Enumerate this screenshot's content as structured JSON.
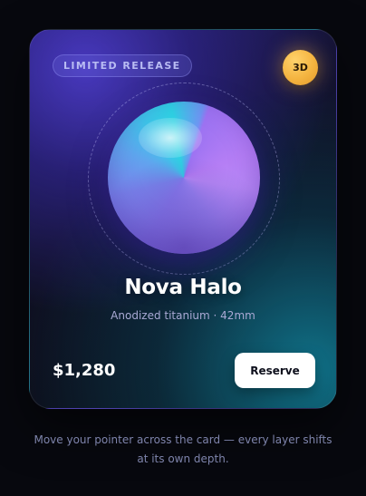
{
  "card": {
    "badge": "LIMITED RELEASE",
    "mode_chip": "3D",
    "title": "Nova Halo",
    "subtitle": "Anodized titanium · 42mm",
    "price": "$1,280",
    "reserve_label": "Reserve"
  },
  "caption": {
    "line1": "Move your pointer across the card — every layer shifts",
    "line2": "at its own depth."
  },
  "colors": {
    "background": "#07080e",
    "accent_gold": "#f4b440",
    "orb_violet": "#9d73f2",
    "orb_cyan": "#2ed2e3",
    "button": "#ffffff"
  }
}
